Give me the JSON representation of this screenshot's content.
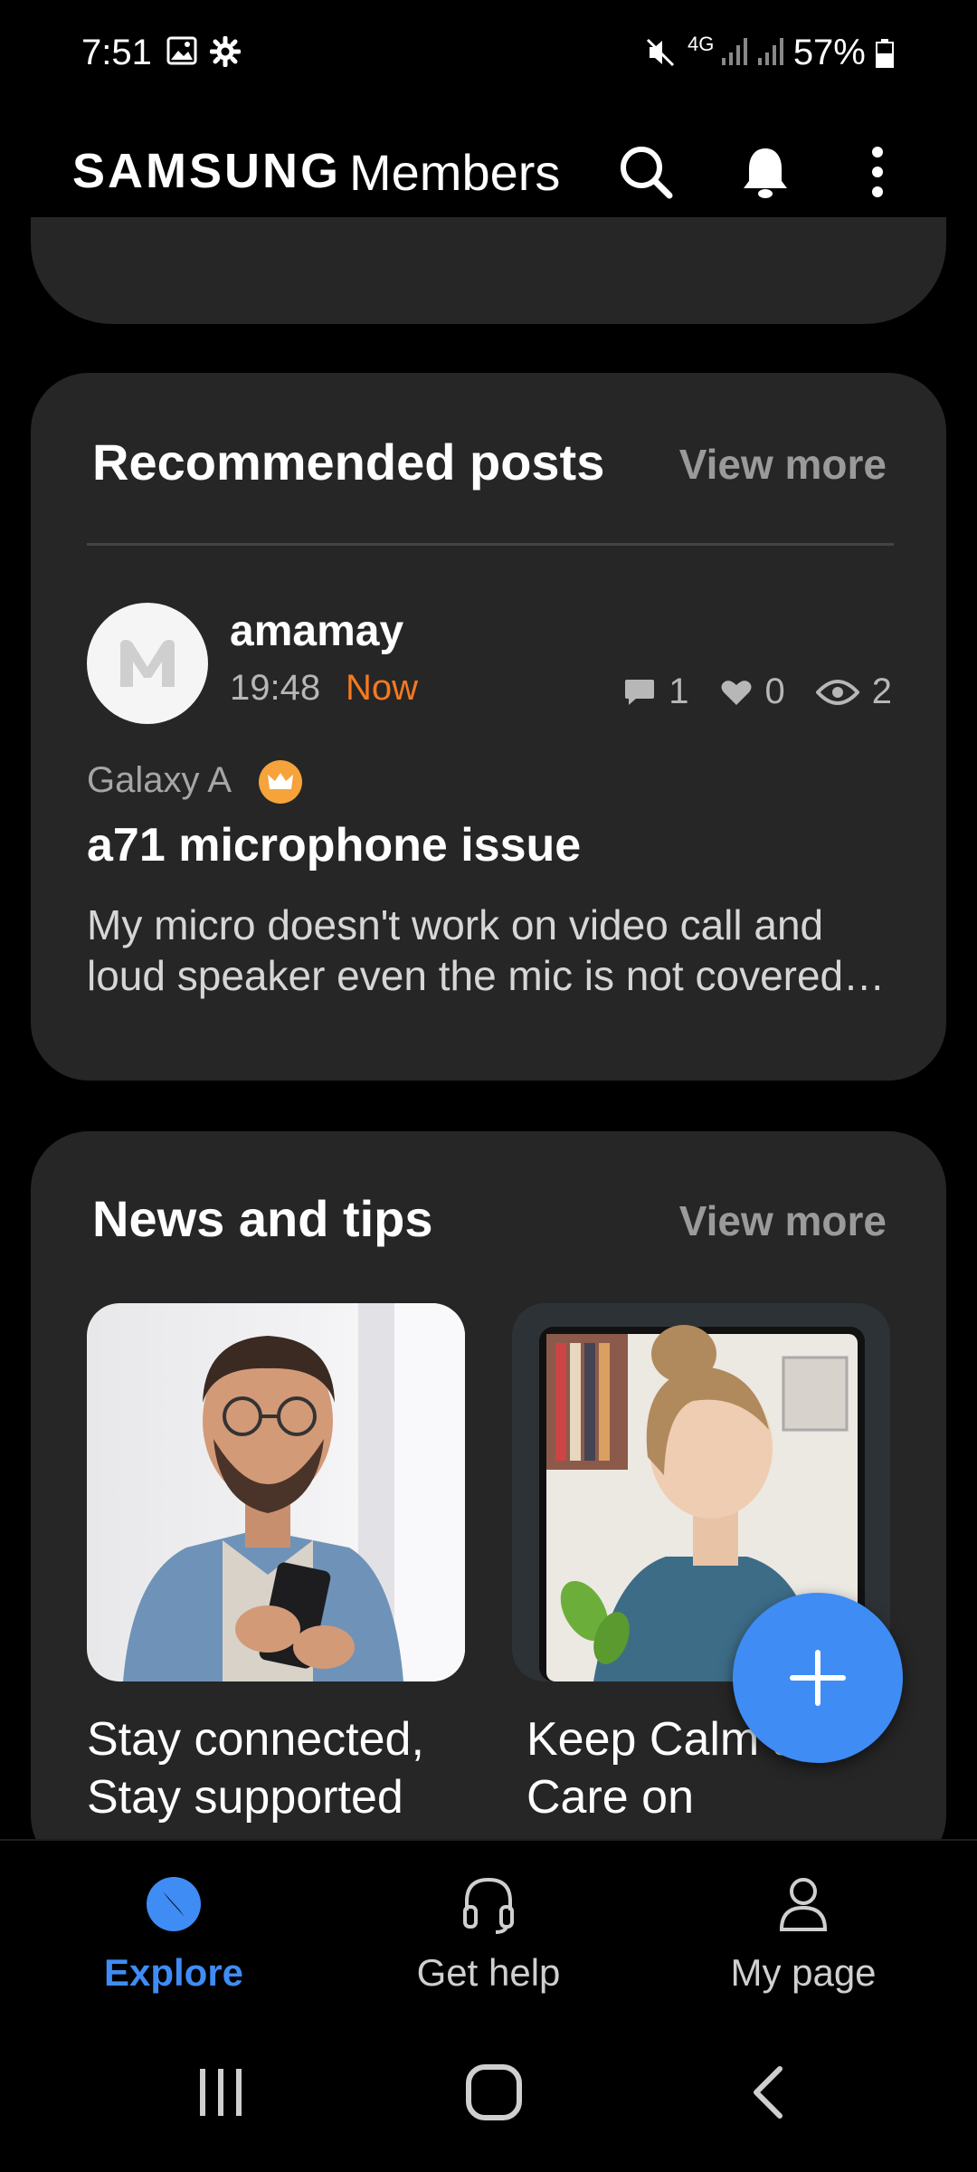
{
  "status_bar": {
    "time": "7:51",
    "battery": "57%",
    "network": "4G"
  },
  "app_bar": {
    "brand": "SAMSUNG",
    "app_name": "Members",
    "icons": [
      "search-icon",
      "bell-icon",
      "more-vert-icon"
    ]
  },
  "recommended": {
    "title": "Recommended posts",
    "view_more": "View more",
    "post": {
      "author": "amamay",
      "time": "19:48",
      "badge": "Now",
      "comments": "1",
      "likes": "0",
      "views": "2",
      "category": "Galaxy A",
      "title": "a71 microphone issue",
      "body": "My micro doesn't work on video call and loud speaker even the mic is not covered…"
    }
  },
  "news": {
    "title": "News and tips",
    "view_more": "View more",
    "items": [
      {
        "caption": "Stay connected, Stay supported"
      },
      {
        "caption": "Keep Calm and Care on"
      }
    ]
  },
  "bottom_nav": {
    "items": [
      {
        "label": "Explore",
        "active": true
      },
      {
        "label": "Get help",
        "active": false
      },
      {
        "label": "My page",
        "active": false
      }
    ]
  },
  "colors": {
    "accent": "#3f8cf5",
    "now": "#f5791f",
    "card": "#262626"
  }
}
